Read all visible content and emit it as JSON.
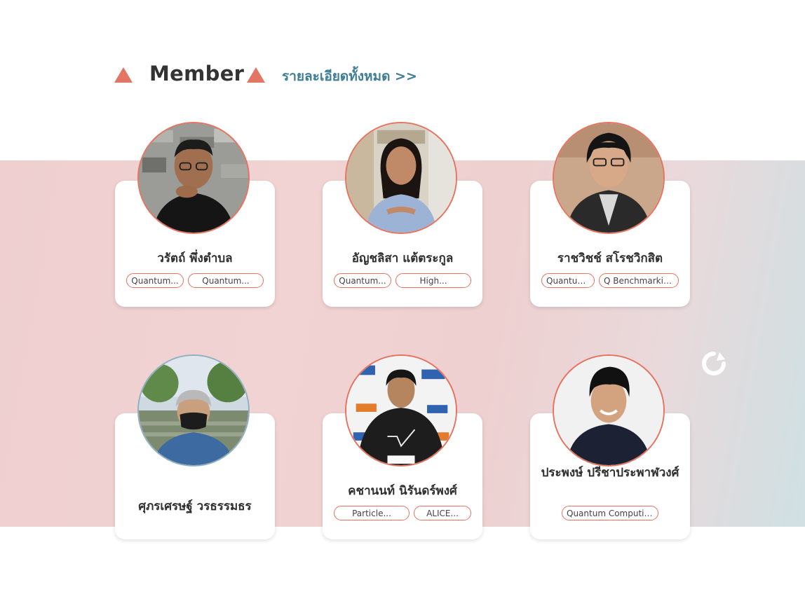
{
  "header": {
    "title": "Member",
    "more_link": "รายละเอียดทั้งหมด >>"
  },
  "colors": {
    "accent": "#e27563",
    "link": "#3e7e96",
    "band_start": "#efcfcf",
    "band_end": "#cfe0e3"
  },
  "members": [
    {
      "name": "วรัตถ์ พึ่งตำบล",
      "tags": [
        "Quantum...",
        "Quantum..."
      ]
    },
    {
      "name": "อัญชลิสา แต้ตระกูล",
      "tags": [
        "Quantum...",
        "High..."
      ]
    },
    {
      "name": "ราชวิชช์ สโรชวิกสิต",
      "tags": [
        "Quantum...",
        "Q Benchmarkin..."
      ]
    },
    {
      "name": "ศุภรเศรษฐ์ วรธรรมธร",
      "tags": []
    },
    {
      "name": "คชานนท์ นิรันดร์พงศ์",
      "tags": [
        "Particle...",
        "ALICE..."
      ]
    },
    {
      "name": "ประพงษ์ ปรีชาประพาฬวงศ์",
      "tags": [
        "Quantum Computing"
      ]
    }
  ],
  "icons": {
    "reload": "refresh-icon"
  }
}
